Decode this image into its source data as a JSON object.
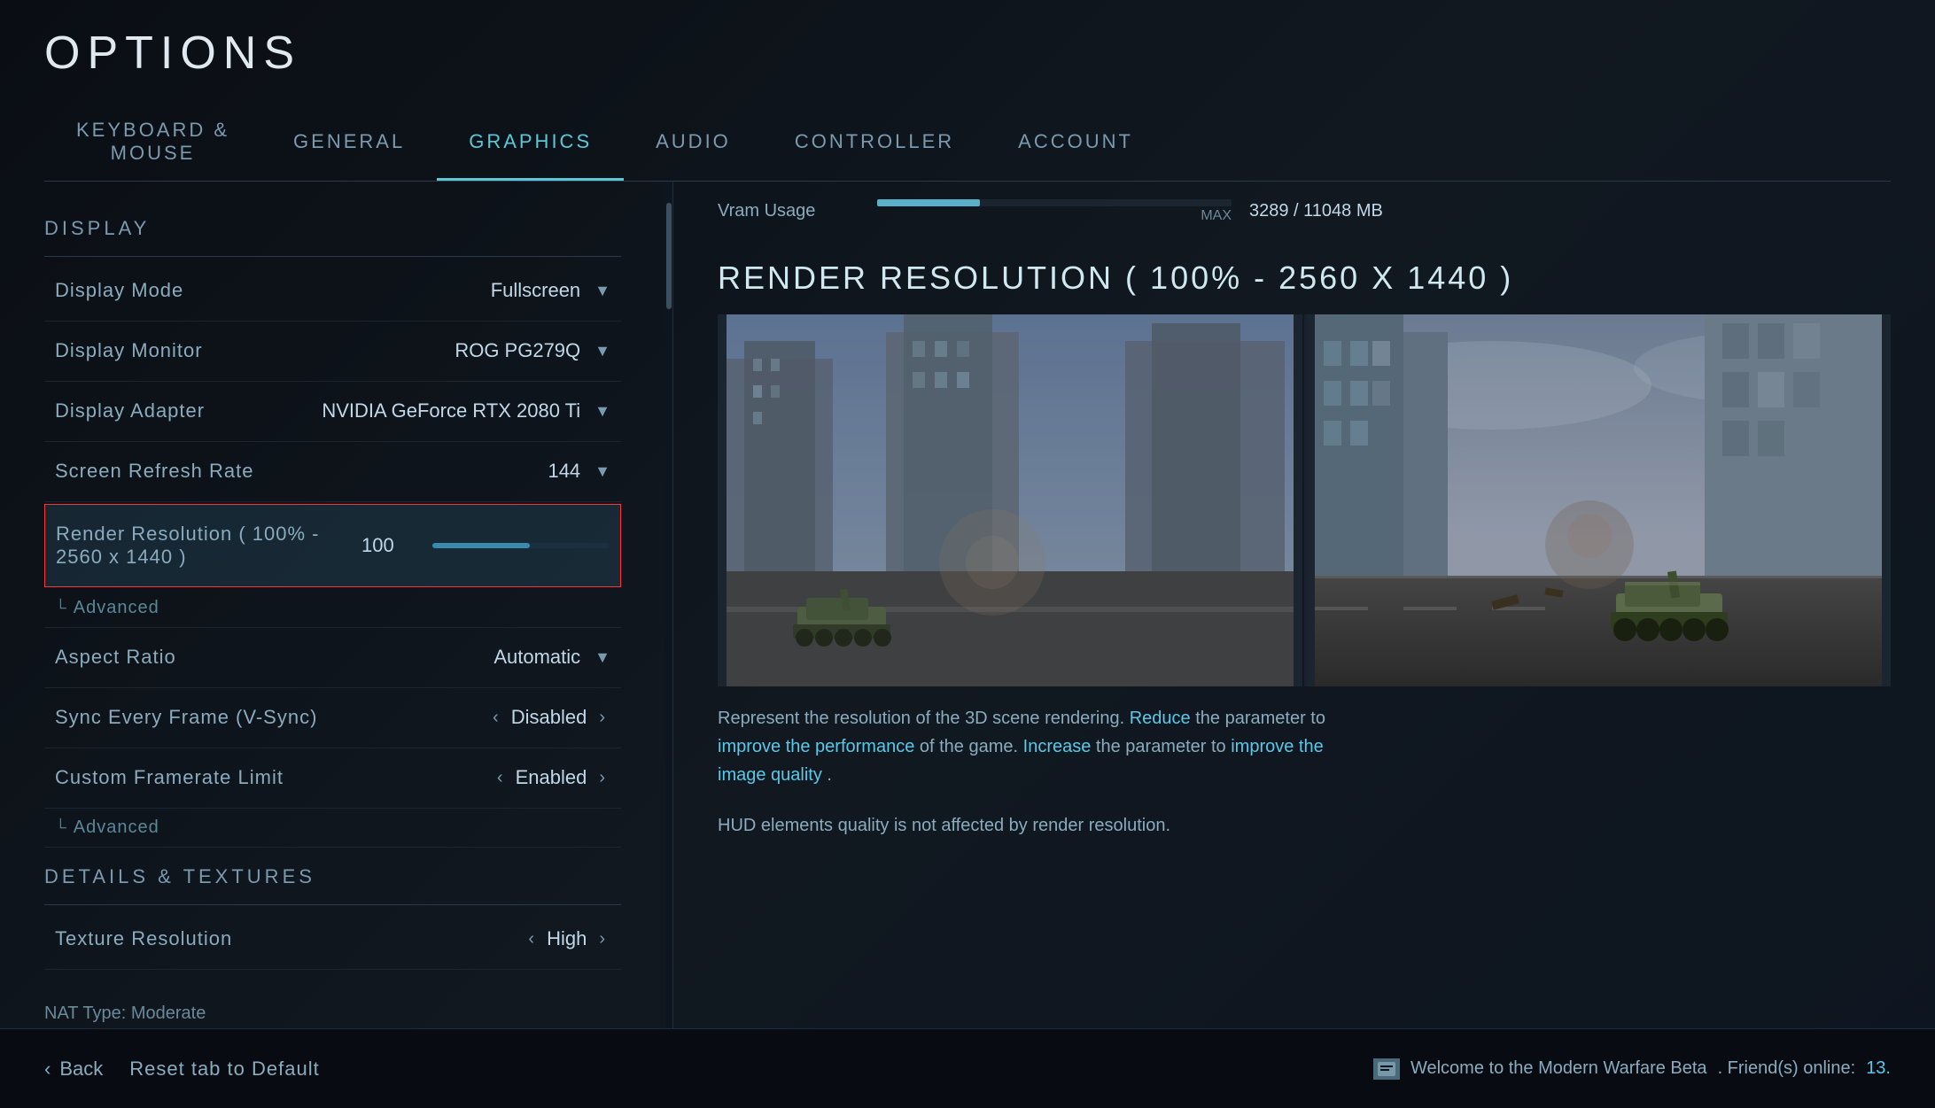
{
  "page": {
    "title": "OPTIONS"
  },
  "nav": {
    "tabs": [
      {
        "id": "keyboard-mouse",
        "label": "KEYBOARD &\nMOUSE",
        "active": false
      },
      {
        "id": "general",
        "label": "GENERAL",
        "active": false
      },
      {
        "id": "graphics",
        "label": "GRAPHICS",
        "active": true
      },
      {
        "id": "audio",
        "label": "AUDIO",
        "active": false
      },
      {
        "id": "controller",
        "label": "CONTROLLER",
        "active": false
      },
      {
        "id": "account",
        "label": "ACCOUNT",
        "active": false
      }
    ]
  },
  "settings": {
    "display_section_label": "DISPLAY",
    "items": [
      {
        "label": "Display Mode",
        "value": "Fullscreen",
        "type": "dropdown"
      },
      {
        "label": "Display Monitor",
        "value": "ROG PG279Q",
        "type": "dropdown"
      },
      {
        "label": "Display Adapter",
        "value": "NVIDIA GeForce RTX 2080 Ti",
        "type": "dropdown"
      },
      {
        "label": "Screen Refresh Rate",
        "value": "144",
        "type": "dropdown"
      },
      {
        "label": "Render Resolution ( 100% - 2560 x 1440 )",
        "value": "100",
        "type": "slider",
        "highlighted": true,
        "slider_pct": 55
      },
      {
        "label": "Aspect Ratio",
        "value": "Automatic",
        "type": "dropdown"
      },
      {
        "label": "Sync Every Frame (V-Sync)",
        "value": "Disabled",
        "type": "arrows"
      },
      {
        "label": "Custom Framerate Limit",
        "value": "Enabled",
        "type": "arrows"
      }
    ],
    "advanced_label": "Advanced",
    "details_section_label": "DETAILS & TEXTURES",
    "details_items": [
      {
        "label": "Texture Resolution",
        "value": "High",
        "type": "arrows"
      }
    ]
  },
  "info_panel": {
    "vram": {
      "label": "Vram Usage",
      "current": "3289",
      "total": "11048",
      "unit": "MB",
      "max_label": "MAX",
      "fill_pct": 29
    },
    "render_title": "RENDER RESOLUTION ( 100% - 2560 X 1440 )",
    "description": {
      "part1": "Represent the resolution of the 3D scene rendering. ",
      "reduce": "Reduce",
      "part2": " the parameter to ",
      "improve_perf": "improve the performance",
      "part3": " of the game. ",
      "increase": "Increase",
      "part4": " the parameter to ",
      "improve_quality": "improve the image quality",
      "part5": "."
    },
    "hud_note": "HUD elements quality is not affected by render resolution."
  },
  "bottom": {
    "back_label": "Back",
    "reset_label": "Reset tab to Default",
    "status_text": "Welcome to the Modern Warfare Beta",
    "friends_label": ". Friend(s) online: ",
    "friends_count": "13."
  },
  "nat_type": "NAT Type: Moderate"
}
